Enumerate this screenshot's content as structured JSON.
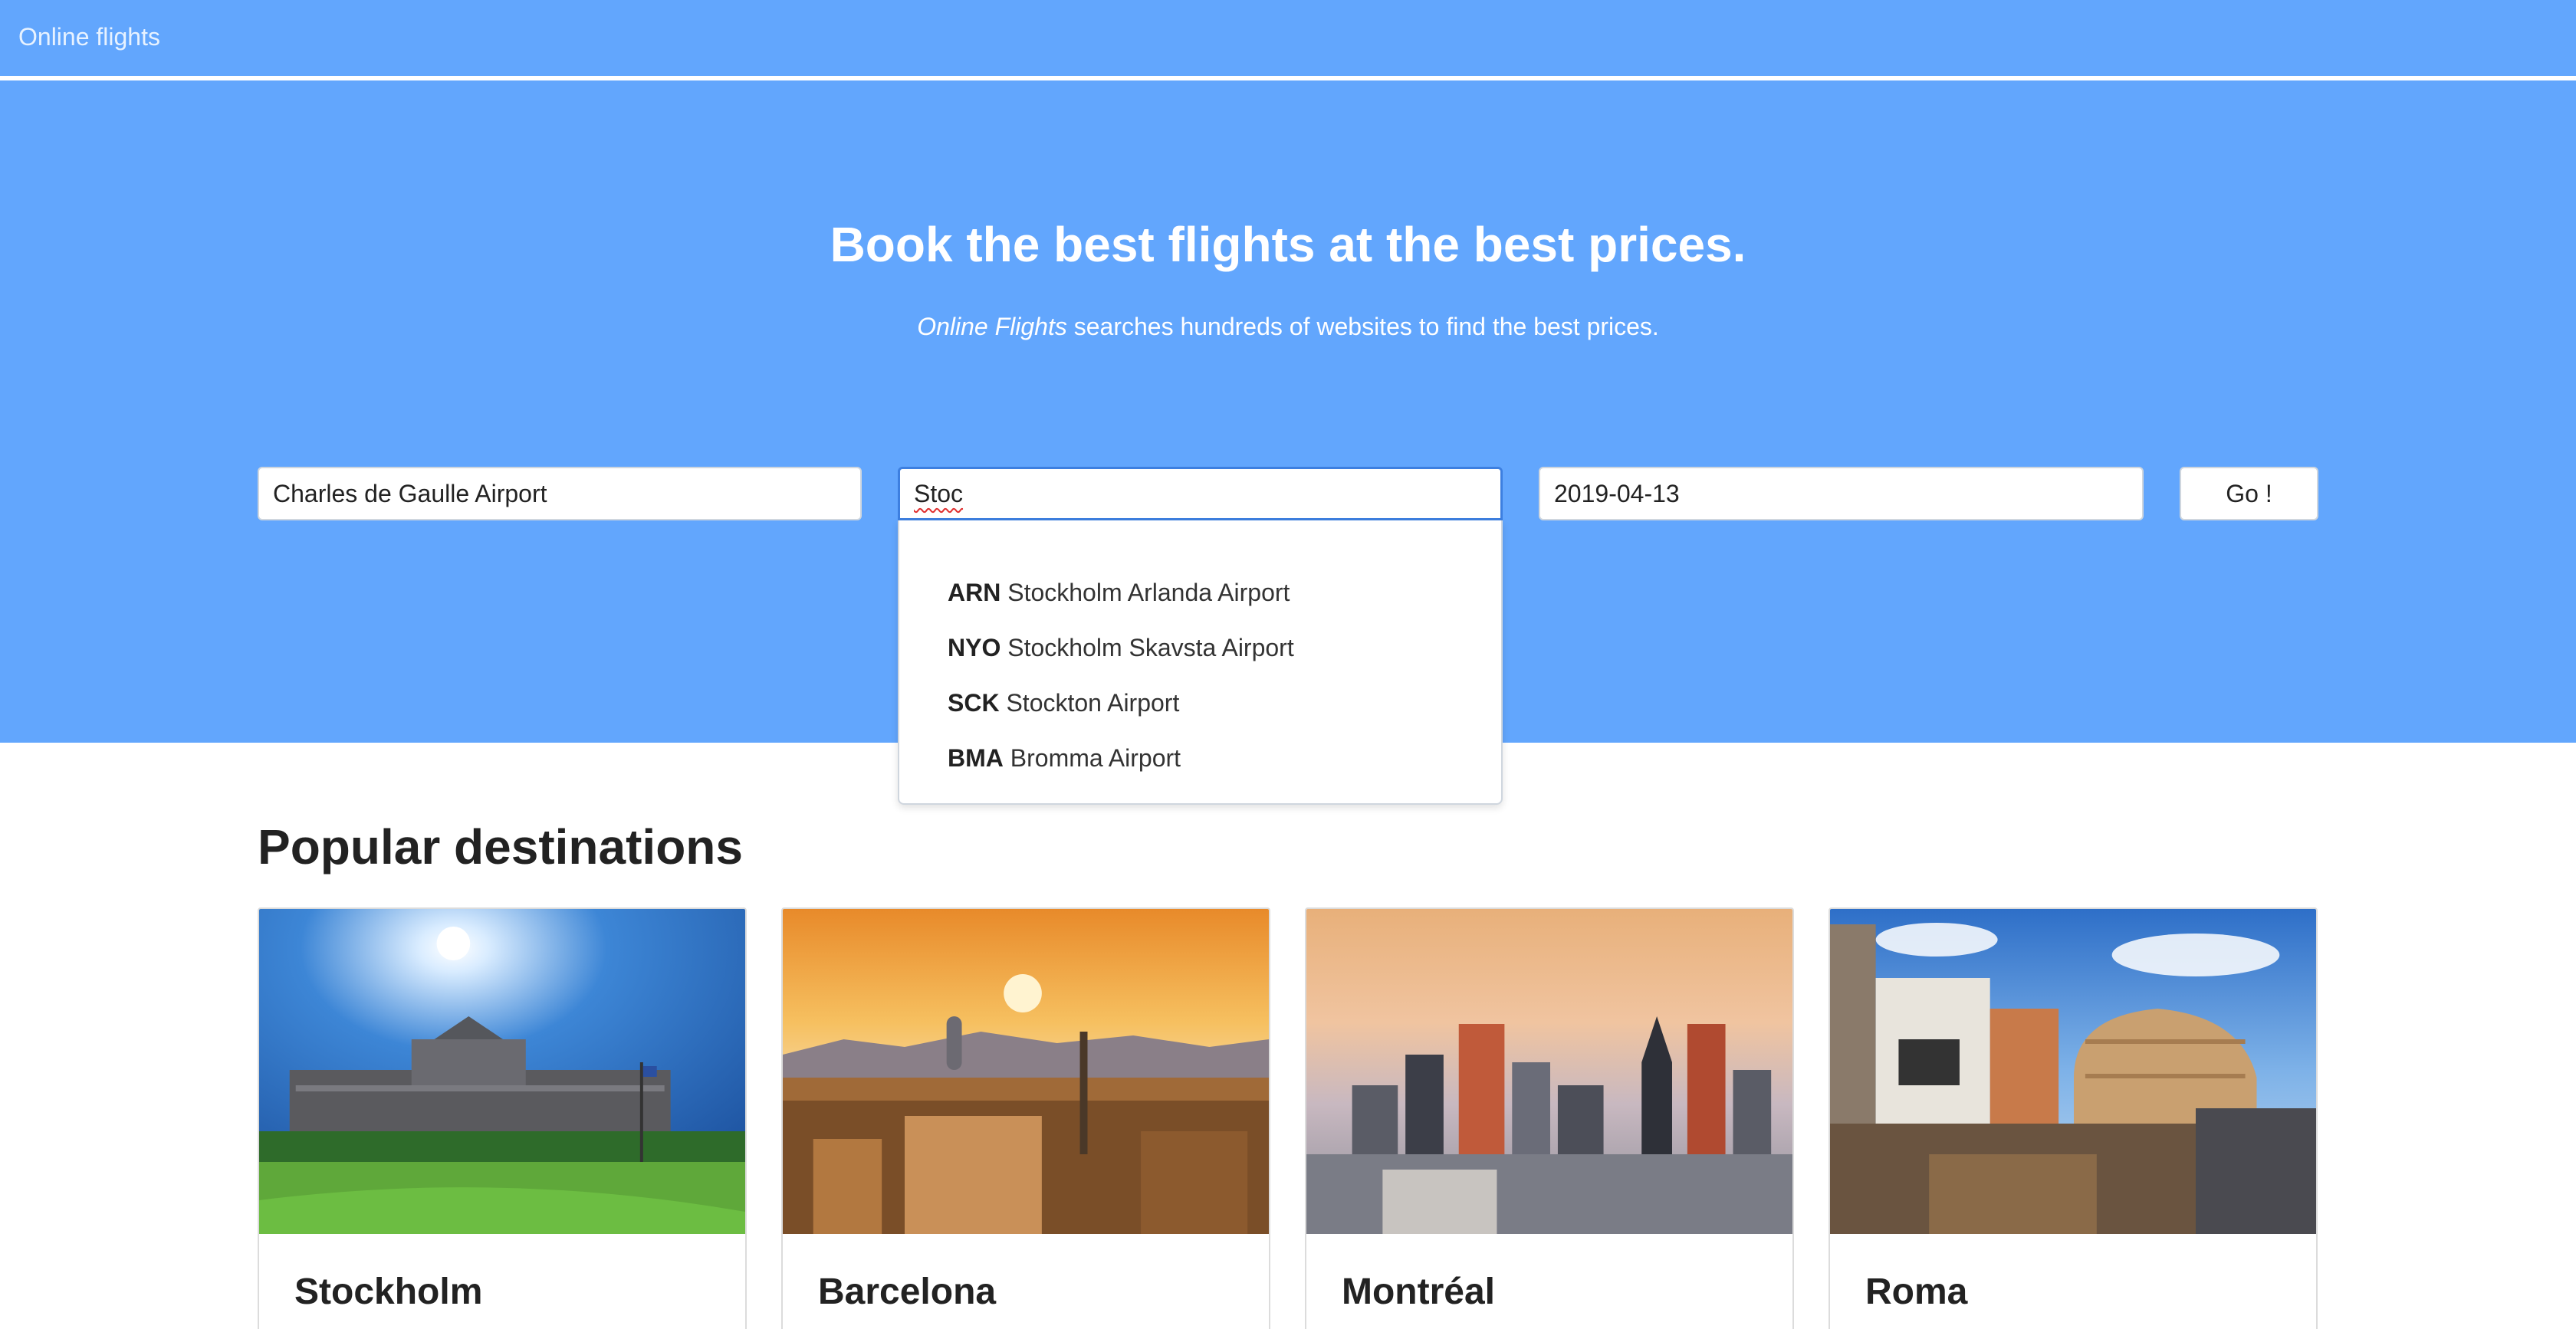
{
  "navbar": {
    "brand": "Online flights"
  },
  "hero": {
    "title": "Book the best flights at the best prices.",
    "subtitle_em": "Online Flights",
    "subtitle_rest": " searches hundreds of websites to find the best prices."
  },
  "search": {
    "from_value": "Charles de Gaulle Airport",
    "to_value": "Stoc",
    "date_value": "2019-04-13",
    "go_label": "Go !"
  },
  "suggestions": [
    {
      "code": "ARN",
      "name": "Stockholm Arlanda Airport"
    },
    {
      "code": "NYO",
      "name": "Stockholm Skavsta Airport"
    },
    {
      "code": "SCK",
      "name": "Stockton Airport"
    },
    {
      "code": "BMA",
      "name": "Bromma Airport"
    }
  ],
  "destinations": {
    "title": "Popular destinations",
    "cards": [
      {
        "name": "Stockholm"
      },
      {
        "name": "Barcelona"
      },
      {
        "name": "Montréal"
      },
      {
        "name": "Roma"
      }
    ]
  },
  "colors": {
    "hero_bg": "#62a6fd",
    "focus_border": "#3d7fe0"
  }
}
